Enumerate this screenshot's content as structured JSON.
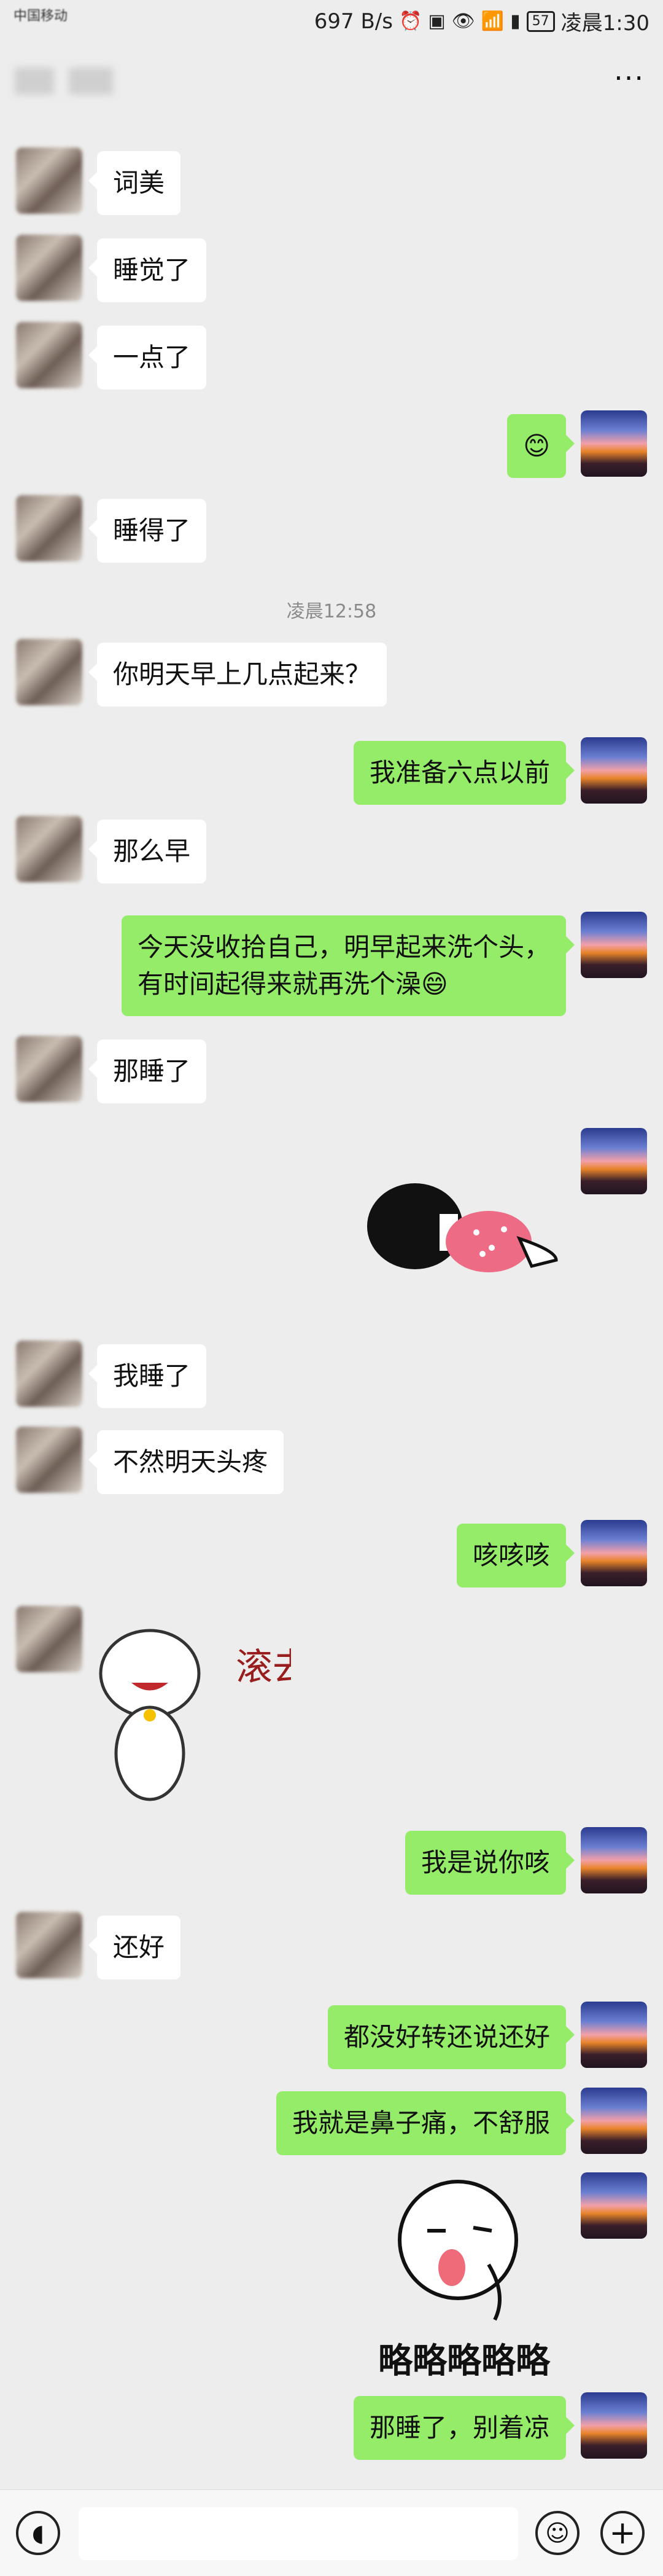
{
  "status_bar": {
    "carrier": "中国移动",
    "speed": "697 B/s",
    "battery": "57",
    "time": "凌晨1:30"
  },
  "header": {
    "more_label": "···"
  },
  "timestamp": "凌晨12:58",
  "messages": [
    {
      "side": "left",
      "text": "词美"
    },
    {
      "side": "left",
      "text": "睡觉了"
    },
    {
      "side": "left",
      "text": "一点了"
    },
    {
      "side": "right",
      "text": "😊"
    },
    {
      "side": "left",
      "text": "睡得了"
    },
    {
      "side": "left",
      "text": "你明天早上几点起来？"
    },
    {
      "side": "right",
      "text": "我准备六点以前"
    },
    {
      "side": "left",
      "text": "那么早"
    },
    {
      "side": "right",
      "text": "今天没收拾自己，明早起来洗个头，"
    },
    {
      "side": "right",
      "text": "有时间起得来就再洗个澡😄"
    },
    {
      "side": "left",
      "text": "那睡了"
    },
    {
      "side": "left",
      "text": "我睡了"
    },
    {
      "side": "left",
      "text": "不然明天头疼"
    },
    {
      "side": "right",
      "text": "咳咳咳"
    },
    {
      "side": "right",
      "text": "我是说你咳"
    },
    {
      "side": "left",
      "text": "还好"
    },
    {
      "side": "right",
      "text": "都没好转还说还好"
    },
    {
      "side": "right",
      "text": "我就是鼻子痛，不舒服"
    },
    {
      "side": "right",
      "text": "那睡了，别着凉"
    }
  ],
  "stickers": {
    "cat_text": "滚去睡!!!",
    "lueh_text": "略略略略略"
  },
  "icons": {
    "voice": "voice-icon",
    "emoji": "emoji-icon",
    "plus": "plus-icon",
    "more": "more-icon"
  }
}
